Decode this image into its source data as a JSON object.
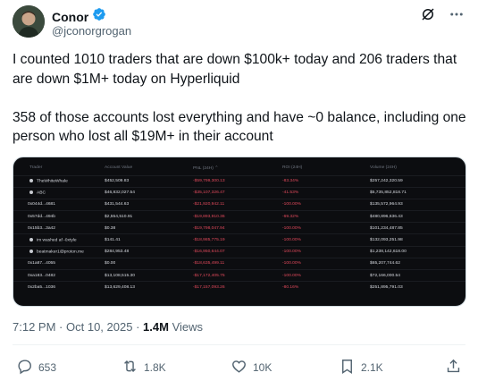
{
  "author": {
    "name": "Conor",
    "handle": "@jconorgrogan",
    "verified": true
  },
  "tweet": {
    "line1": "I counted 1010 traders that are down $100k+ today and 206 traders that are down $1M+ today on Hyperliquid",
    "line2": "358 of those accounts lost everything and have ~0 balance, including one person who lost all $19M+ in their account"
  },
  "table": {
    "headers": [
      "Trader",
      "Account Value",
      "PNL (24H) ⌃",
      "ROI (24H)",
      "Volume (24H)"
    ],
    "rows": [
      {
        "trader": "TheWhiteWhale",
        "user": true,
        "account": "$452,509.83",
        "pnl": "-$59,799,300.13",
        "roi": "-83.34%",
        "volume": "$257,242,320.59"
      },
      {
        "trader": "ABC",
        "user": true,
        "account": "$46,832,027.54",
        "pnl": "-$35,107,326.47",
        "roi": "-41.53%",
        "volume": "$5,735,852,818.71"
      },
      {
        "trader": "0x044d...4681",
        "user": false,
        "account": "$431,544.63",
        "pnl": "-$21,920,942.11",
        "roi": "-100.00%",
        "volume": "$135,572,964.93"
      },
      {
        "trader": "0x57dd...494b",
        "user": false,
        "account": "$2,554,510.91",
        "pnl": "-$19,893,910.36",
        "roi": "-69.32%",
        "volume": "$480,896,636.43"
      },
      {
        "trader": "0x15b3...3a42",
        "user": false,
        "account": "$0.38",
        "pnl": "-$19,798,047.94",
        "roi": "-100.00%",
        "volume": "$101,234,487.85"
      },
      {
        "trader": "im washed af -0xtyle",
        "user": true,
        "account": "$141.41",
        "pnl": "-$18,985,775.19",
        "roi": "-100.00%",
        "volume": "$132,093,251.98"
      },
      {
        "trader": "beatmaker1@proton.me",
        "user": true,
        "account": "$284,953.48",
        "pnl": "-$16,950,644.07",
        "roi": "-100.00%",
        "volume": "$1,238,142,618.00"
      },
      {
        "trader": "0x1a87...4055",
        "user": false,
        "account": "$0.00",
        "pnl": "-$18,635,499.11",
        "roi": "-100.00%",
        "volume": "$65,207,744.62"
      },
      {
        "trader": "0xa183...0482",
        "user": false,
        "account": "$13,108,515.30",
        "pnl": "-$17,172,405.75",
        "roi": "-100.00%",
        "volume": "$72,166,000.54"
      },
      {
        "trader": "0x2ba5...1036",
        "user": false,
        "account": "$13,629,408.13",
        "pnl": "-$17,157,093.26",
        "roi": "-80.16%",
        "volume": "$251,895,791.03"
      }
    ]
  },
  "meta": {
    "time": "7:12 PM",
    "date": "Oct 10, 2025",
    "views_count": "1.4M",
    "views_label": "Views"
  },
  "actions": {
    "replies": "653",
    "reposts": "1.8K",
    "likes": "10K",
    "bookmarks": "2.1K"
  },
  "colors": {
    "verified": "#1d9bf0",
    "text": "#0f1419",
    "muted": "#536471",
    "negative": "#e0495b",
    "table_bg": "#0c0d10"
  }
}
